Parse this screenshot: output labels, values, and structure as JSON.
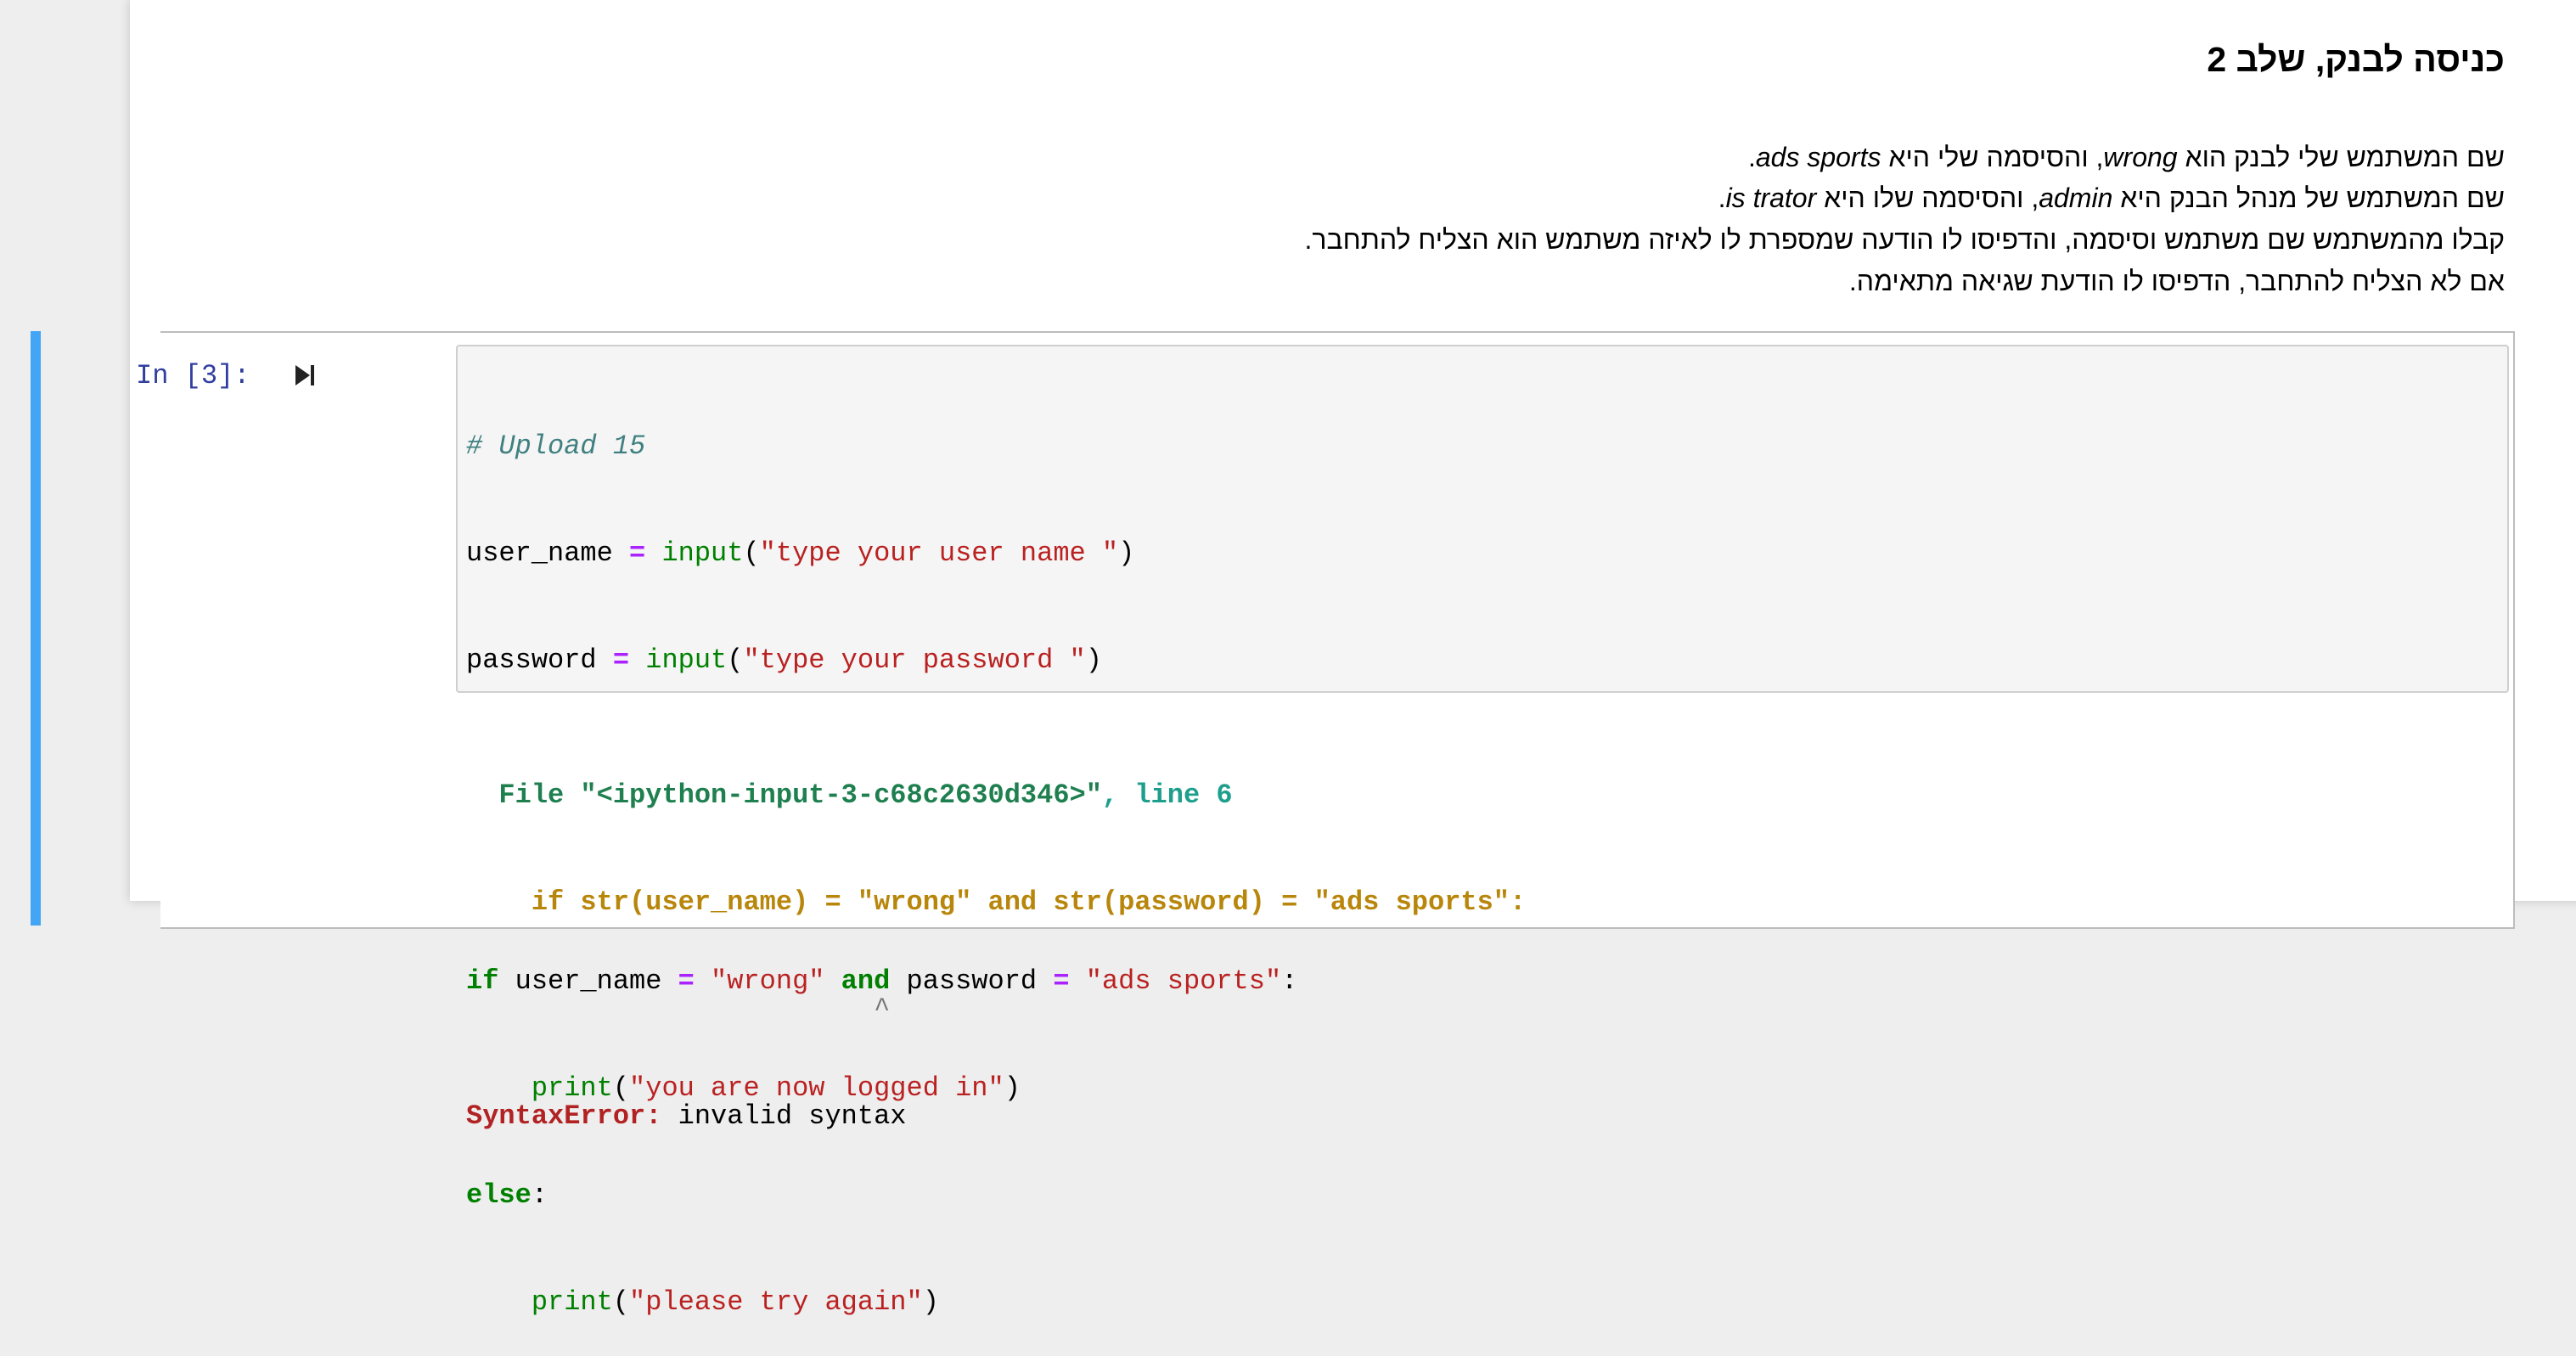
{
  "markdown": {
    "title": "כניסה לבנק, שלב 2",
    "line1": {
      "a": "שם המשתמש שלי לבנק הוא ",
      "b": "wrong",
      "c": ", והסיסמה שלי היא ",
      "d": "ads sports",
      "e": "."
    },
    "line2": {
      "a": "שם המשתמש של מנהל הבנק היא ",
      "b": "admin",
      "c": ", והסיסמה שלו היא ",
      "d": "is trator",
      "e": "."
    },
    "line3": "קבלו מהמשתמש שם משתמש וסיסמה, והדפיסו לו הודעה שמספרת לו לאיזה משתמש הוא הצליח להתחבר.",
    "line4": "אם לא הצליח להתחבר, הדפיסו לו הודעת שגיאה מתאימה."
  },
  "cell": {
    "prompt": "In [3]:",
    "code": {
      "comment": "# Upload 15",
      "l2": {
        "a": "user_name ",
        "op": "=",
        "b": " ",
        "fn": "input",
        "c": "(",
        "s": "\"type your user name \"",
        "d": ")"
      },
      "l3": {
        "a": "password ",
        "op": "=",
        "b": " ",
        "fn": "input",
        "c": "(",
        "s": "\"type your password \"",
        "d": ")"
      },
      "l6": {
        "kw": "if",
        "a": " user_name ",
        "op1": "=",
        "b": " ",
        "s1": "\"wrong\"",
        "c": " ",
        "kw2": "and",
        "d": " password ",
        "op2": "=",
        "e": " ",
        "s2": "\"ads sports\"",
        "f": ":"
      },
      "l7": {
        "indent": "    ",
        "fn": "print",
        "a": "(",
        "s": "\"you are now logged in\"",
        "b": ")"
      },
      "l8": {
        "kw": "else",
        "a": ":"
      },
      "l9": {
        "indent": "    ",
        "fn": "print",
        "a": "(",
        "s": "\"please try again\"",
        "b": ")"
      }
    },
    "output": {
      "file_prefix": "  File ",
      "file_name": "\"<ipython-input-3-c68c2630d346>\"",
      "line_label": ", line 6",
      "source": "    if str(user_name) = \"wrong\" and str(password) = \"ads sports\":",
      "caret": "                         ^",
      "error_type": "SyntaxError:",
      "error_msg": " invalid syntax"
    }
  },
  "colors": {
    "cell_bar": "#42a5f5",
    "prompt": "#303f9f"
  }
}
